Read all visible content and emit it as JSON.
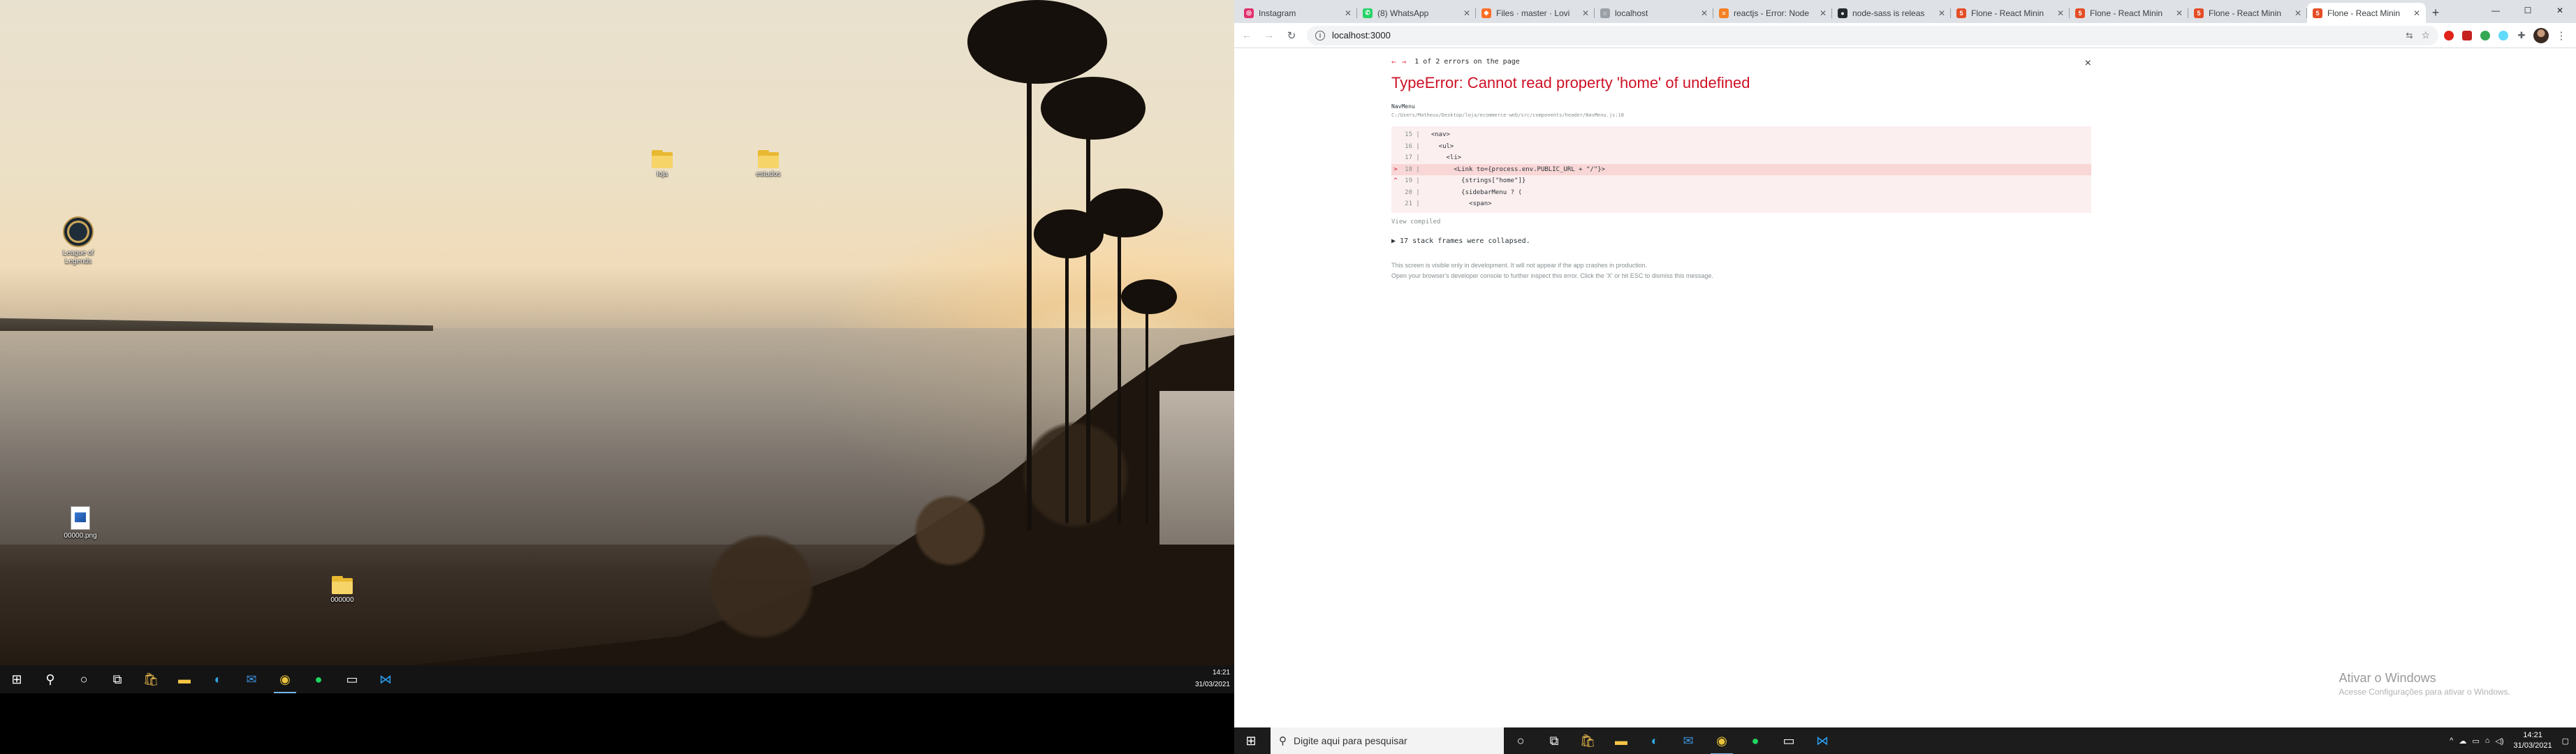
{
  "left_desktop": {
    "icons": [
      {
        "label": "League of Legends"
      },
      {
        "label": "Ioja"
      },
      {
        "label": "estudos"
      },
      {
        "label": "00000.png"
      },
      {
        "label": "000000"
      }
    ]
  },
  "left_taskbar": {
    "time": "14:21",
    "date": "31/03/2021"
  },
  "browser": {
    "tabs": [
      {
        "title": "Instagram",
        "favicon_color": "#e1306c",
        "favicon": "◎"
      },
      {
        "title": "(8) WhatsApp",
        "favicon_color": "#25d366",
        "favicon": "✆"
      },
      {
        "title": "Files · master · Lovi",
        "favicon_color": "#fc6d26",
        "favicon": "◆"
      },
      {
        "title": "localhost",
        "favicon_color": "#9aa0a6",
        "favicon": "○"
      },
      {
        "title": "reactjs - Error: Node",
        "favicon_color": "#f48024",
        "favicon": "≡"
      },
      {
        "title": "node-sass is releas",
        "favicon_color": "#24292e",
        "favicon": "●"
      },
      {
        "title": "Flone - React Minin",
        "favicon_color": "#e44d26",
        "favicon": "5"
      },
      {
        "title": "Flone - React Minin",
        "favicon_color": "#e44d26",
        "favicon": "5"
      },
      {
        "title": "Flone - React Minin",
        "favicon_color": "#e44d26",
        "favicon": "5"
      },
      {
        "title": "Flone - React Minin",
        "favicon_color": "#e44d26",
        "favicon": "5",
        "active": true
      }
    ],
    "new_tab": "+",
    "window_controls": {
      "minimize": "—",
      "maximize": "☐",
      "close": "✕"
    },
    "url": "localhost:3000"
  },
  "error_overlay": {
    "nav_prev": "←",
    "nav_next": "→",
    "count_text": "1 of 2 errors on the page",
    "close": "×",
    "title": "TypeError: Cannot read property 'home' of undefined",
    "component": "NavMenu",
    "file_path": "C:/Users/Matheus/Desktop/loja/ecommerce-web/src/components/header/NavMenu.js:18",
    "code_lines": [
      {
        "num": "15",
        "mark": "",
        "code": "  <nav>"
      },
      {
        "num": "16",
        "mark": "",
        "code": "    <ul>"
      },
      {
        "num": "17",
        "mark": "",
        "code": "      <li>"
      },
      {
        "num": "18",
        "mark": ">",
        "code": "        <Link to={process.env.PUBLIC_URL + \"/\"}>"
      },
      {
        "num": "19",
        "mark": "^",
        "code": "          {strings[\"home\"]}"
      },
      {
        "num": "20",
        "mark": "",
        "code": "          {sidebarMenu ? ("
      },
      {
        "num": "21",
        "mark": "",
        "code": "            <span>"
      }
    ],
    "view_compiled": "View compiled",
    "collapsed": "▶ 17 stack frames were collapsed.",
    "footer_line1": "This screen is visible only in development. It will not appear if the app crashes in production.",
    "footer_line2": "Open your browser's developer console to further inspect this error.  Click the 'X' or hit ESC to dismiss this message."
  },
  "watermark": {
    "title": "Ativar o Windows",
    "subtitle": "Acesse Configurações para ativar o Windows."
  },
  "right_taskbar": {
    "search_placeholder": "Digite aqui para pesquisar",
    "time": "14:21",
    "date": "31/03/2021"
  },
  "colors": {
    "error_red": "#ce1126",
    "code_bg": "#fcefef",
    "taskbar": "#1c1c1c"
  }
}
